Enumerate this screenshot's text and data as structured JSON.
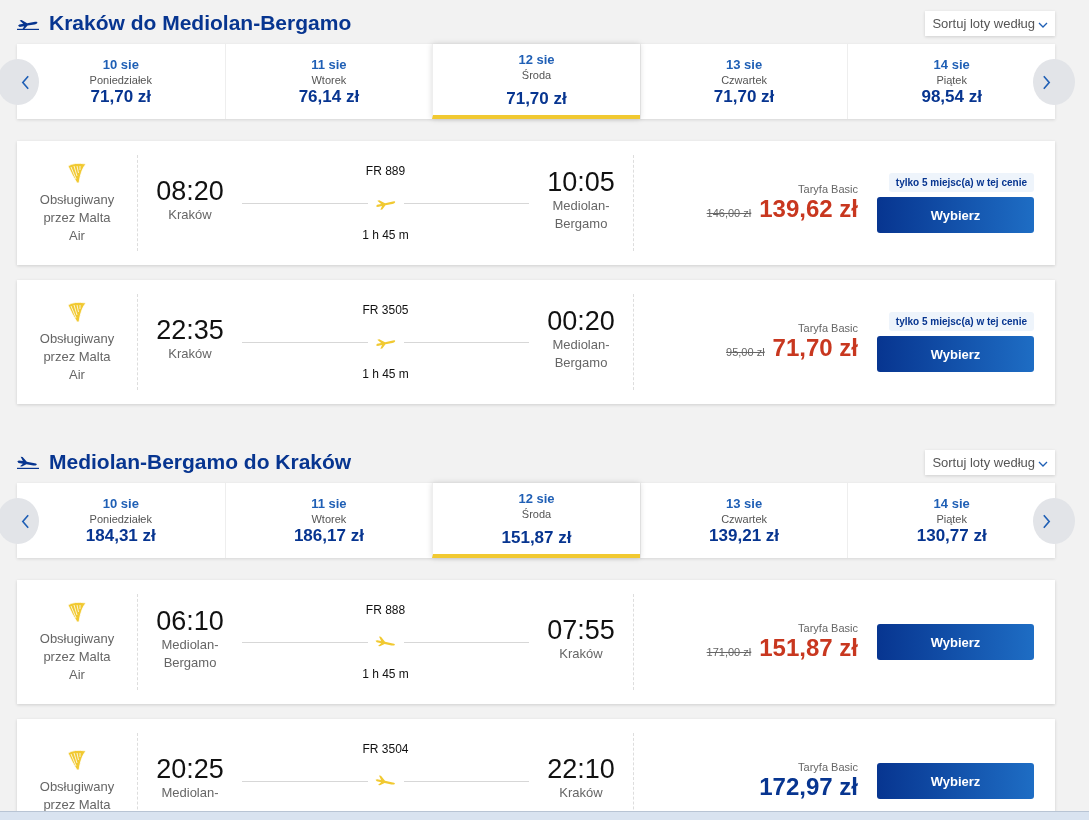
{
  "sections": [
    {
      "kind": "outbound",
      "title": "Kraków do Mediolan-Bergamo",
      "sort_label": "Sortuj loty według",
      "dates": [
        {
          "date": "10 sie",
          "weekday": "Poniedziałek",
          "price": "71,70 zł",
          "selected": false
        },
        {
          "date": "11 sie",
          "weekday": "Wtorek",
          "price": "76,14 zł",
          "selected": false
        },
        {
          "date": "12 sie",
          "weekday": "Środa",
          "price": "71,70 zł",
          "selected": true
        },
        {
          "date": "13 sie",
          "weekday": "Czwartek",
          "price": "71,70 zł",
          "selected": false
        },
        {
          "date": "14 sie",
          "weekday": "Piątek",
          "price": "98,54 zł",
          "selected": false
        }
      ],
      "flights": [
        {
          "operator": "Obsługiwany przez Malta Air",
          "dep_time": "08:20",
          "dep_city": "Kraków",
          "flight_no": "FR 889",
          "duration": "1 h 45 m",
          "arr_time": "10:05",
          "arr_city": "Mediolan-Bergamo",
          "fare_label": "Taryfa Basic",
          "old_price": "146,00 zł",
          "price": "139,62 zł",
          "badge": "tylko 5 miejsc(a) w tej cenie",
          "button": "Wybierz"
        },
        {
          "operator": "Obsługiwany przez Malta Air",
          "dep_time": "22:35",
          "dep_city": "Kraków",
          "flight_no": "FR 3505",
          "duration": "1 h 45 m",
          "arr_time": "00:20",
          "arr_city": "Mediolan-Bergamo",
          "fare_label": "Taryfa Basic",
          "old_price": "95,00 zł",
          "price": "71,70 zł",
          "badge": "tylko 5 miejsc(a) w tej cenie",
          "button": "Wybierz"
        }
      ]
    },
    {
      "kind": "return",
      "title": "Mediolan-Bergamo do Kraków",
      "sort_label": "Sortuj loty według",
      "dates": [
        {
          "date": "10 sie",
          "weekday": "Poniedziałek",
          "price": "184,31 zł",
          "selected": false
        },
        {
          "date": "11 sie",
          "weekday": "Wtorek",
          "price": "186,17 zł",
          "selected": false
        },
        {
          "date": "12 sie",
          "weekday": "Środa",
          "price": "151,87 zł",
          "selected": true
        },
        {
          "date": "13 sie",
          "weekday": "Czwartek",
          "price": "139,21 zł",
          "selected": false
        },
        {
          "date": "14 sie",
          "weekday": "Piątek",
          "price": "130,77 zł",
          "selected": false
        }
      ],
      "flights": [
        {
          "operator": "Obsługiwany przez Malta Air",
          "dep_time": "06:10",
          "dep_city": "Mediolan-Bergamo",
          "flight_no": "FR 888",
          "duration": "1 h 45 m",
          "arr_time": "07:55",
          "arr_city": "Kraków",
          "fare_label": "Taryfa Basic",
          "old_price": "171,00 zł",
          "price": "151,87 zł",
          "button": "Wybierz"
        },
        {
          "operator": "Obsługiwany przez Malta",
          "dep_time": "20:25",
          "dep_city": "Mediolan-",
          "flight_no": "FR 3504",
          "arr_time": "22:10",
          "arr_city": "Kraków",
          "fare_label": "Taryfa Basic",
          "price": "172,97 zł",
          "button": "Wybierz"
        }
      ]
    }
  ]
}
